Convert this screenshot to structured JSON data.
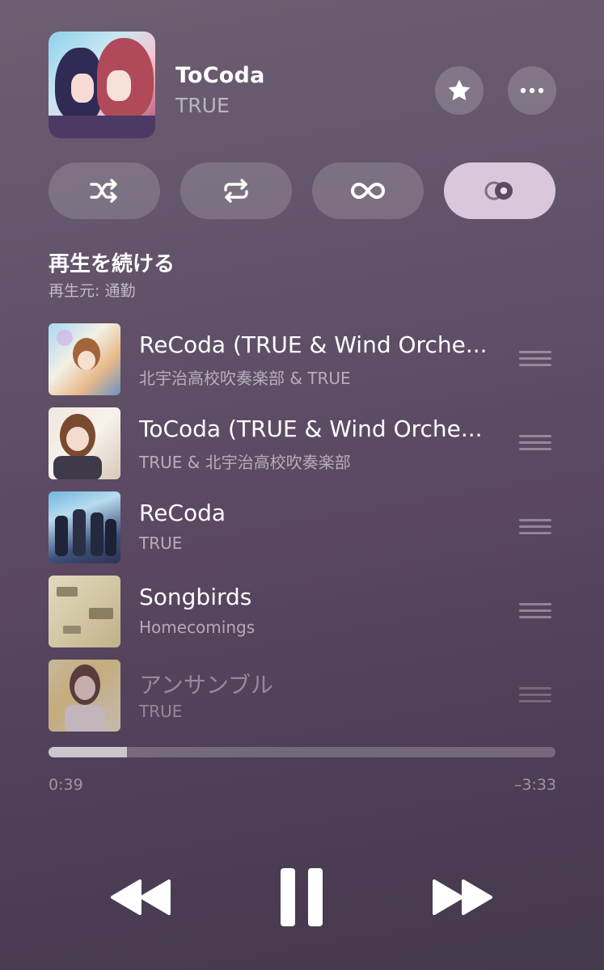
{
  "now_playing": {
    "title": "ToCoda",
    "artist": "TRUE"
  },
  "actions": {
    "favorite_icon": "star-icon",
    "more_icon": "ellipsis-icon"
  },
  "modes": [
    {
      "icon": "shuffle-icon",
      "active": false
    },
    {
      "icon": "repeat-icon",
      "active": false
    },
    {
      "icon": "infinity-icon",
      "active": false
    },
    {
      "icon": "autoplay-icon",
      "active": true
    }
  ],
  "section": {
    "title": "再生を続ける",
    "subtitle": "再生元: 通勤"
  },
  "queue": [
    {
      "title": "ReCoda (TRUE & Wind Orche...",
      "artist": "北宇治高校吹奏楽部 & TRUE"
    },
    {
      "title": "ToCoda (TRUE & Wind Orche...",
      "artist": "TRUE & 北宇治高校吹奏楽部"
    },
    {
      "title": "ReCoda",
      "artist": "TRUE"
    },
    {
      "title": "Songbirds",
      "artist": "Homecomings"
    },
    {
      "title": "アンサンブル",
      "artist": "TRUE"
    }
  ],
  "progress": {
    "elapsed": "0:39",
    "remaining": "–3:33",
    "fraction": 0.155
  },
  "colors": {
    "accent_active_pill": "#f0dcf0",
    "background_top": "#6d5f72",
    "background_bottom": "#45394d"
  }
}
